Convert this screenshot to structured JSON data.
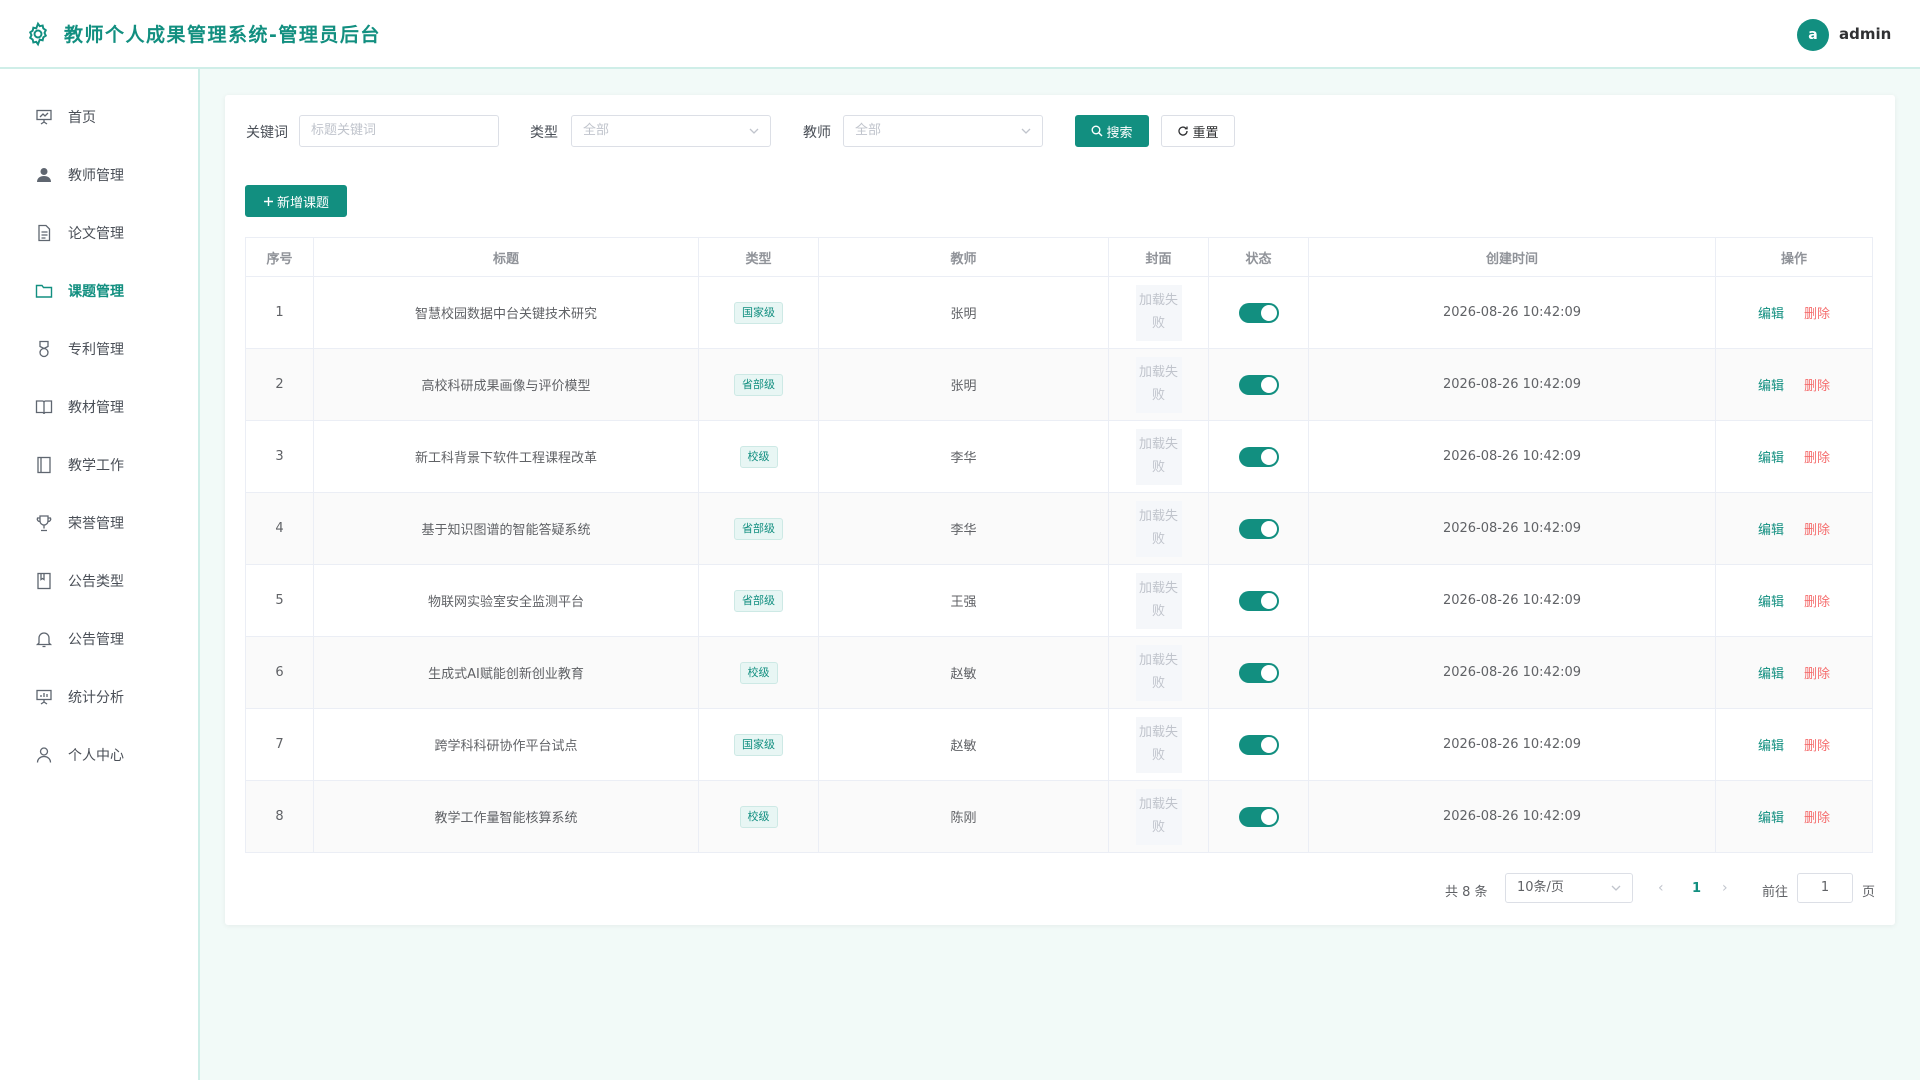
{
  "header": {
    "title": "教师个人成果管理系统-管理员后台",
    "avatar_letter": "a",
    "username": "admin",
    "accent_color": "#128f80"
  },
  "sidebar": {
    "items": [
      {
        "label": "首页",
        "icon": "presentation-icon",
        "active": false
      },
      {
        "label": "教师管理",
        "icon": "user-icon",
        "active": false
      },
      {
        "label": "论文管理",
        "icon": "document-icon",
        "active": false
      },
      {
        "label": "课题管理",
        "icon": "folder-icon",
        "active": true
      },
      {
        "label": "专利管理",
        "icon": "medal-icon",
        "active": false
      },
      {
        "label": "教材管理",
        "icon": "book-open-icon",
        "active": false
      },
      {
        "label": "教学工作",
        "icon": "notebook-icon",
        "active": false
      },
      {
        "label": "荣誉管理",
        "icon": "trophy-icon",
        "active": false
      },
      {
        "label": "公告类型",
        "icon": "notepad-icon",
        "active": false
      },
      {
        "label": "公告管理",
        "icon": "bell-icon",
        "active": false
      },
      {
        "label": "统计分析",
        "icon": "chart-board-icon",
        "active": false
      },
      {
        "label": "个人中心",
        "icon": "user-outline-icon",
        "active": false
      }
    ]
  },
  "filters": {
    "keyword_label": "关键词",
    "keyword_placeholder": "标题关键词",
    "type_label": "类型",
    "type_value": "全部",
    "teacher_label": "教师",
    "teacher_value": "全部",
    "search_label": "搜索",
    "reset_label": "重置"
  },
  "toolbar": {
    "add_label": "新增课题"
  },
  "table": {
    "columns": [
      "序号",
      "标题",
      "类型",
      "教师",
      "封面",
      "状态",
      "创建时间",
      "操作"
    ],
    "cover_text": "加载失败",
    "edit_label": "编辑",
    "delete_label": "删除",
    "rows": [
      {
        "index": "1",
        "title": "智慧校园数据中台关键技术研究",
        "type": "国家级",
        "teacher": "张明",
        "enabled": true,
        "created": "2026-08-26 10:42:09"
      },
      {
        "index": "2",
        "title": "高校科研成果画像与评价模型",
        "type": "省部级",
        "teacher": "张明",
        "enabled": true,
        "created": "2026-08-26 10:42:09"
      },
      {
        "index": "3",
        "title": "新工科背景下软件工程课程改革",
        "type": "校级",
        "teacher": "李华",
        "enabled": true,
        "created": "2026-08-26 10:42:09"
      },
      {
        "index": "4",
        "title": "基于知识图谱的智能答疑系统",
        "type": "省部级",
        "teacher": "李华",
        "enabled": true,
        "created": "2026-08-26 10:42:09"
      },
      {
        "index": "5",
        "title": "物联网实验室安全监测平台",
        "type": "省部级",
        "teacher": "王强",
        "enabled": true,
        "created": "2026-08-26 10:42:09"
      },
      {
        "index": "6",
        "title": "生成式AI赋能创新创业教育",
        "type": "校级",
        "teacher": "赵敏",
        "enabled": true,
        "created": "2026-08-26 10:42:09"
      },
      {
        "index": "7",
        "title": "跨学科科研协作平台试点",
        "type": "国家级",
        "teacher": "赵敏",
        "enabled": true,
        "created": "2026-08-26 10:42:09"
      },
      {
        "index": "8",
        "title": "教学工作量智能核算系统",
        "type": "校级",
        "teacher": "陈刚",
        "enabled": true,
        "created": "2026-08-26 10:42:09"
      }
    ]
  },
  "pagination": {
    "total_text": "共 8 条",
    "page_size": "10条/页",
    "current_page": "1",
    "goto_label": "前往",
    "goto_value": "1",
    "page_suffix": "页"
  }
}
